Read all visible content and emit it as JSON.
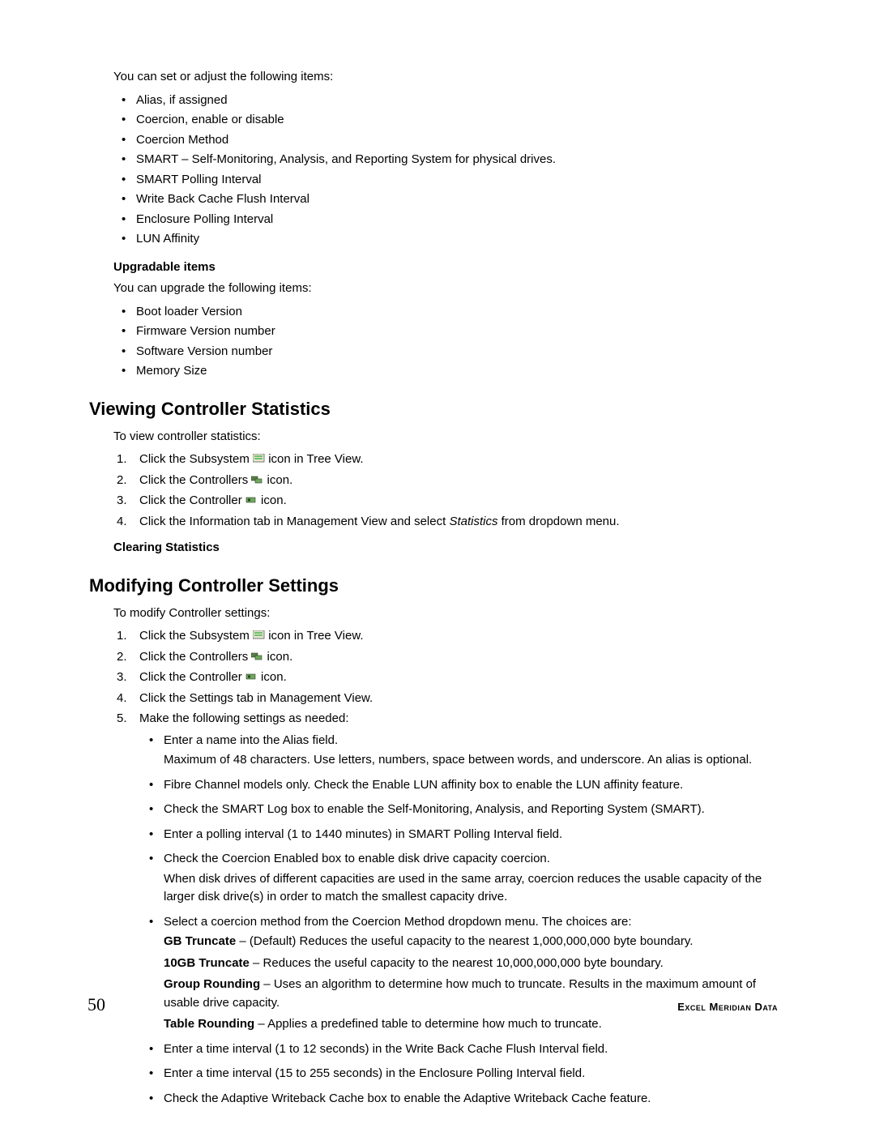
{
  "intro": "You can set or adjust the following items:",
  "adjustable_items": [
    "Alias, if assigned",
    "Coercion, enable or disable",
    "Coercion Method",
    "SMART – Self-Monitoring, Analysis, and Reporting System for physical drives.",
    "SMART Polling Interval",
    "Write Back Cache Flush Interval",
    "Enclosure Polling Interval",
    "LUN Affinity"
  ],
  "upgradable_heading": "Upgradable items",
  "upgradable_intro": "You can upgrade the following items:",
  "upgradable_items": [
    "Boot loader Version",
    "Firmware Version number",
    "Software Version number",
    "Memory Size"
  ],
  "viewing_heading": "Viewing Controller Statistics",
  "viewing_intro": "To view controller statistics:",
  "viewing_steps": {
    "s1a": "Click the Subsystem ",
    "s1b": " icon in Tree View.",
    "s2a": "Click the Controllers ",
    "s2b": " icon.",
    "s3a": "Click the Controller ",
    "s3b": " icon.",
    "s4a": "Click the Information tab in Management View and select ",
    "s4i": "Statistics",
    "s4b": " from dropdown menu."
  },
  "clearing_heading": "Clearing Statistics",
  "modify_heading": "Modifying Controller Settings",
  "modify_intro": "To modify Controller settings:",
  "modify_steps": {
    "s1a": "Click the Subsystem ",
    "s1b": " icon in Tree View.",
    "s2a": "Click the Controllers ",
    "s2b": " icon.",
    "s3a": "Click the Controller ",
    "s3b": " icon.",
    "s4": "Click the Settings tab in Management View.",
    "s5": "Make the following settings as needed:"
  },
  "settings_sub": {
    "alias1": "Enter a name into the Alias field.",
    "alias2": "Maximum of 48 characters. Use letters, numbers, space between words, and underscore. An alias is optional.",
    "fc": "Fibre Channel models only. Check the Enable LUN affinity box to enable the LUN affinity feature.",
    "smart": "Check the SMART Log box to enable the Self-Monitoring, Analysis, and Reporting System (SMART).",
    "polling": "Enter a polling interval (1 to 1440 minutes) in SMART Polling Interval field.",
    "coerc1": "Check the Coercion Enabled box to enable disk drive capacity coercion.",
    "coerc2": "When disk drives of different capacities are used in the same array, coercion reduces the usable capacity of the larger disk drive(s) in order to match the smallest capacity drive.",
    "method_intro": "Select a coercion method from the Coercion Method dropdown menu. The choices are:",
    "gb_t": "GB Truncate",
    "gb_d": " – (Default) Reduces the useful capacity to the nearest 1,000,000,000 byte boundary.",
    "tgb_t": "10GB Truncate",
    "tgb_d": " – Reduces the useful capacity to the nearest 10,000,000,000 byte boundary.",
    "grp_t": "Group Rounding",
    "grp_d": " – Uses an algorithm to determine how much to truncate. Results in the maximum amount of usable drive capacity.",
    "tbl_t": "Table Rounding",
    "tbl_d": " – Applies a predefined table to determine how much to truncate.",
    "wb": "Enter a time interval (1 to 12 seconds) in the Write Back Cache Flush Interval field.",
    "encl": "Enter a time interval (15 to 255 seconds) in the Enclosure Polling Interval field.",
    "awc": "Check the Adaptive Writeback Cache box to enable the Adaptive Writeback Cache feature."
  },
  "footer": {
    "page": "50",
    "brand": "Excel Meridian Data"
  }
}
